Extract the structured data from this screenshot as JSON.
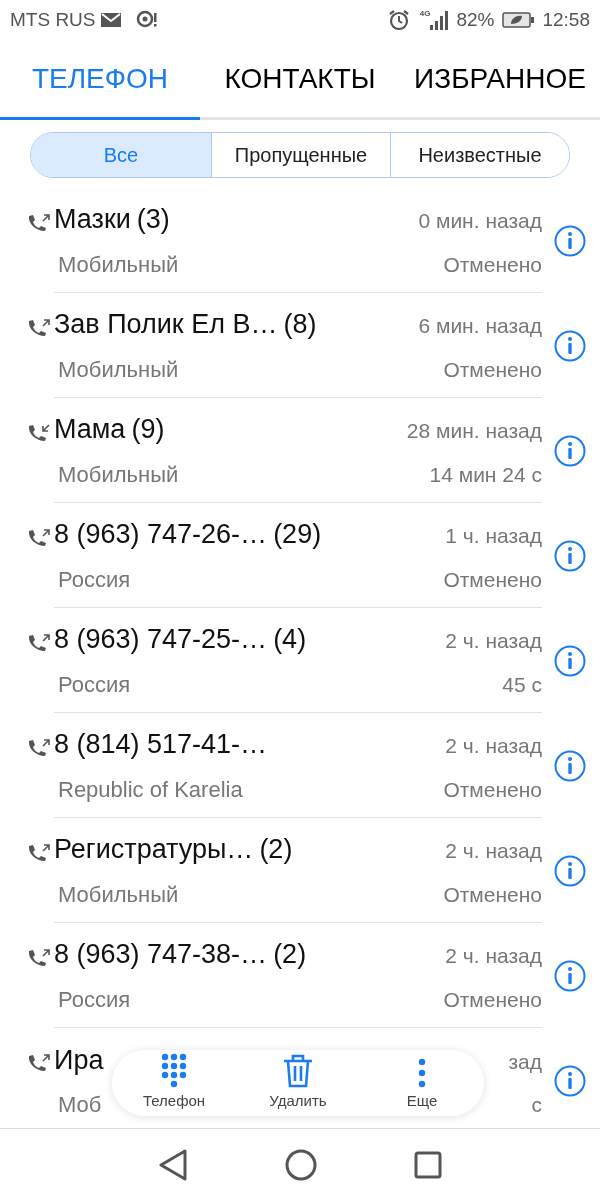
{
  "status_bar": {
    "carrier": "MTS RUS",
    "network": "4G",
    "battery": "82%",
    "time": "12:58"
  },
  "tabs": [
    {
      "label": "ТЕЛЕФОН",
      "selected": true
    },
    {
      "label": "КОНТАКТЫ",
      "selected": false
    },
    {
      "label": "ИЗБРАННОЕ",
      "selected": false
    }
  ],
  "filters": [
    {
      "label": "Все",
      "selected": true
    },
    {
      "label": "Пропущенные",
      "selected": false
    },
    {
      "label": "Неизвестные",
      "selected": false
    }
  ],
  "calls": [
    {
      "kind": "outgoing",
      "name": "Мазки",
      "count": "(3)",
      "subtitle": "Мобильный",
      "time": "0 мин. назад",
      "detail": "Отменено"
    },
    {
      "kind": "outgoing",
      "name": "Зав Полик Ел В…",
      "count": "(8)",
      "subtitle": "Мобильный",
      "time": "6 мин. назад",
      "detail": "Отменено"
    },
    {
      "kind": "incoming",
      "name": "Мама",
      "count": "(9)",
      "subtitle": "Мобильный",
      "time": "28 мин. назад",
      "detail": "14 мин 24 с"
    },
    {
      "kind": "outgoing",
      "name": "8 (963) 747-26-…",
      "count": "(29)",
      "subtitle": "Россия",
      "time": "1 ч. назад",
      "detail": "Отменено"
    },
    {
      "kind": "outgoing",
      "name": "8 (963) 747-25-…",
      "count": "(4)",
      "subtitle": "Россия",
      "time": "2 ч. назад",
      "detail": "45 с"
    },
    {
      "kind": "outgoing",
      "name": "8 (814) 517-41-…",
      "subtitle": "Republic of Karelia",
      "time": "2 ч. назад",
      "detail": "Отменено"
    },
    {
      "kind": "outgoing",
      "name": "Регистратуры…",
      "count": "(2)",
      "subtitle": "Мобильный",
      "time": "2 ч. назад",
      "detail": "Отменено"
    },
    {
      "kind": "outgoing",
      "name": "8 (963) 747-38-…",
      "count": "(2)",
      "subtitle": "Россия",
      "time": "2 ч. назад",
      "detail": "Отменено"
    },
    {
      "kind": "outgoing",
      "name": "Ира",
      "subtitle": "Моб",
      "time": "зад",
      "detail": "с"
    }
  ],
  "toolbar": [
    {
      "kind": "dialpad",
      "label": "Телефон"
    },
    {
      "kind": "delete",
      "label": "Удалить"
    },
    {
      "kind": "more",
      "label": "Еще"
    }
  ]
}
